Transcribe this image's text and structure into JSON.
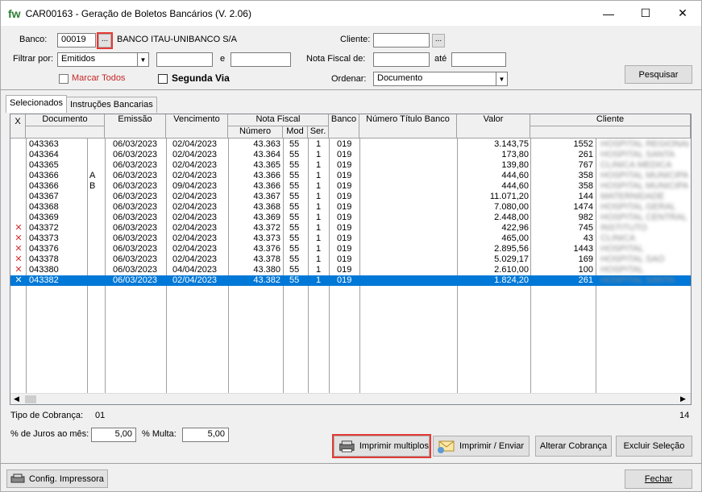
{
  "window": {
    "title": "CAR00163 - Geração de Boletos Bancários   (V. 2.06)",
    "logo": "fw"
  },
  "controls": {
    "minimize": "—",
    "maximize": "☐",
    "close": "✕"
  },
  "filters": {
    "banco_label": "Banco:",
    "banco_code": "00019",
    "banco_dots": "...",
    "banco_name": "BANCO ITAU-UNIBANCO S/A",
    "cliente_label": "Cliente:",
    "cliente_value": "",
    "cliente_dots": "...",
    "filtrar_label": "Filtrar por:",
    "filtrar_value": "Emitidos",
    "filtrar_from": "",
    "e_label": "e",
    "filtrar_to": "",
    "nf_label": "Nota Fiscal de:",
    "nf_from": "",
    "ate_label": "até",
    "nf_to": "",
    "marcar_todos": "Marcar Todos",
    "segunda_via": "Segunda Via",
    "ordenar_label": "Ordenar:",
    "ordenar_value": "Documento",
    "pesquisar": "Pesquisar"
  },
  "tabs": [
    "Selecionados",
    "Instruções Bancarias"
  ],
  "grid": {
    "headers": {
      "x": "X",
      "documento": "Documento",
      "emissao": "Emissão",
      "vencimento": "Vencimento",
      "nota_fiscal": "Nota Fiscal",
      "numero": "Número",
      "mod": "Mod",
      "ser": "Ser.",
      "banco": "Banco",
      "numero_titulo": "Número Título Banco",
      "valor": "Valor",
      "cliente": "Cliente"
    },
    "rows": [
      {
        "x": "",
        "doc": "043363",
        "suf": "",
        "emissao": "06/03/2023",
        "venc": "02/04/2023",
        "num": "43.363",
        "mod": "55",
        "ser": "1",
        "banco": "019",
        "titulo": "",
        "valor": "3.143,75",
        "cliente": "1552",
        "nome": "HOSPITAL REGIONAL"
      },
      {
        "x": "",
        "doc": "043364",
        "suf": "",
        "emissao": "06/03/2023",
        "venc": "02/04/2023",
        "num": "43.364",
        "mod": "55",
        "ser": "1",
        "banco": "019",
        "titulo": "",
        "valor": "173,80",
        "cliente": "261",
        "nome": "HOSPITAL SANTA"
      },
      {
        "x": "",
        "doc": "043365",
        "suf": "",
        "emissao": "06/03/2023",
        "venc": "02/04/2023",
        "num": "43.365",
        "mod": "55",
        "ser": "1",
        "banco": "019",
        "titulo": "",
        "valor": "139,80",
        "cliente": "767",
        "nome": "CLINICA MEDICA"
      },
      {
        "x": "",
        "doc": "043366",
        "suf": "A",
        "emissao": "06/03/2023",
        "venc": "02/04/2023",
        "num": "43.366",
        "mod": "55",
        "ser": "1",
        "banco": "019",
        "titulo": "",
        "valor": "444,60",
        "cliente": "358",
        "nome": "HOSPITAL MUNICIPAL"
      },
      {
        "x": "",
        "doc": "043366",
        "suf": "B",
        "emissao": "06/03/2023",
        "venc": "09/04/2023",
        "num": "43.366",
        "mod": "55",
        "ser": "1",
        "banco": "019",
        "titulo": "",
        "valor": "444,60",
        "cliente": "358",
        "nome": "HOSPITAL MUNICIPAL"
      },
      {
        "x": "",
        "doc": "043367",
        "suf": "",
        "emissao": "06/03/2023",
        "venc": "02/04/2023",
        "num": "43.367",
        "mod": "55",
        "ser": "1",
        "banco": "019",
        "titulo": "",
        "valor": "11.071,20",
        "cliente": "144",
        "nome": "MATERNIDADE"
      },
      {
        "x": "",
        "doc": "043368",
        "suf": "",
        "emissao": "06/03/2023",
        "venc": "02/04/2023",
        "num": "43.368",
        "mod": "55",
        "ser": "1",
        "banco": "019",
        "titulo": "",
        "valor": "7.080,00",
        "cliente": "1474",
        "nome": "HOSPITAL GERAL"
      },
      {
        "x": "",
        "doc": "043369",
        "suf": "",
        "emissao": "06/03/2023",
        "venc": "02/04/2023",
        "num": "43.369",
        "mod": "55",
        "ser": "1",
        "banco": "019",
        "titulo": "",
        "valor": "2.448,00",
        "cliente": "982",
        "nome": "HOSPITAL CENTRAL"
      },
      {
        "x": "✕",
        "doc": "043372",
        "suf": "",
        "emissao": "06/03/2023",
        "venc": "02/04/2023",
        "num": "43.372",
        "mod": "55",
        "ser": "1",
        "banco": "019",
        "titulo": "",
        "valor": "422,96",
        "cliente": "745",
        "nome": "INSTITUTO"
      },
      {
        "x": "✕",
        "doc": "043373",
        "suf": "",
        "emissao": "06/03/2023",
        "venc": "02/04/2023",
        "num": "43.373",
        "mod": "55",
        "ser": "1",
        "banco": "019",
        "titulo": "",
        "valor": "465,00",
        "cliente": "43",
        "nome": "CLINICA"
      },
      {
        "x": "✕",
        "doc": "043376",
        "suf": "",
        "emissao": "06/03/2023",
        "venc": "02/04/2023",
        "num": "43.376",
        "mod": "55",
        "ser": "1",
        "banco": "019",
        "titulo": "",
        "valor": "2.895,56",
        "cliente": "1443",
        "nome": "HOSPITAL"
      },
      {
        "x": "✕",
        "doc": "043378",
        "suf": "",
        "emissao": "06/03/2023",
        "venc": "02/04/2023",
        "num": "43.378",
        "mod": "55",
        "ser": "1",
        "banco": "019",
        "titulo": "",
        "valor": "5.029,17",
        "cliente": "169",
        "nome": "HOSPITAL SAO"
      },
      {
        "x": "✕",
        "doc": "043380",
        "suf": "",
        "emissao": "06/03/2023",
        "venc": "04/04/2023",
        "num": "43.380",
        "mod": "55",
        "ser": "1",
        "banco": "019",
        "titulo": "",
        "valor": "2.610,00",
        "cliente": "100",
        "nome": "HOSPITAL"
      },
      {
        "x": "✕",
        "doc": "043382",
        "suf": "",
        "emissao": "06/03/2023",
        "venc": "02/04/2023",
        "num": "43.382",
        "mod": "55",
        "ser": "1",
        "banco": "019",
        "titulo": "",
        "valor": "1.824,20",
        "cliente": "261",
        "nome": "HOSPITAL SANTA",
        "selected": true
      }
    ]
  },
  "footer": {
    "tipo_label": "Tipo de Cobrança:",
    "tipo_value": "01",
    "count": "14",
    "juros_label": "% de Juros ao mês:",
    "juros_value": "5,00",
    "multa_label": "% Multa:",
    "multa_value": "5,00",
    "imprimir_multiplos": "Imprimir multiplos",
    "imprimir_enviar": "Imprimir / Enviar",
    "alterar_cobranca": "Alterar Cobrança",
    "excluir_selecao": "Excluir Seleção",
    "config_impressora": "Config. Impressora",
    "fechar": "Fechar"
  }
}
